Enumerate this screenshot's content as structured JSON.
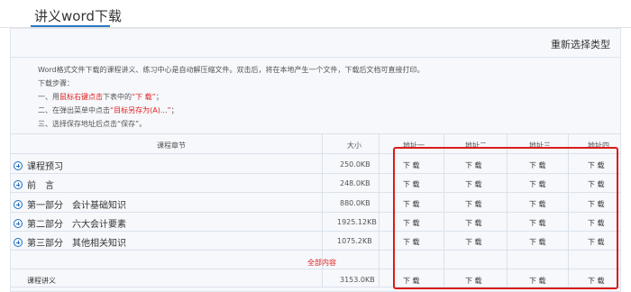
{
  "tab": {
    "title": "讲义word下载"
  },
  "toolbar": {
    "reselect_label": "重新选择类型"
  },
  "intro": {
    "line1": "Word格式文件下载的课程讲义、练习中心是自动解压缩文件。双击后，将在本地产生一个文件，下载后文档可直接打印。",
    "line2": "下载步骤：",
    "line3_a": "一、用",
    "line3_b": "鼠标右键点击",
    "line3_c": "下表中的",
    "line3_d": "“下 载”",
    "line3_e": "；",
    "line4_a": "二、在弹出菜单中点击",
    "line4_b": "“目标另存为(A)...”",
    "line4_c": "；",
    "line5": "三、选择保存地址后点击“保存”。"
  },
  "table": {
    "headers": {
      "chapter": "课程章节",
      "size": "大小",
      "addr1": "地址一",
      "addr2": "地址二",
      "addr3": "地址三",
      "addr4": "地址四"
    },
    "download_label": "下 载",
    "rows": [
      {
        "name": "课程预习",
        "size": "250.0KB"
      },
      {
        "name": "前　言",
        "size": "248.0KB"
      },
      {
        "name": "第一部分　会计基础知识",
        "size": "880.0KB"
      },
      {
        "name": "第二部分　六大会计要素",
        "size": "1925.12KB"
      },
      {
        "name": "第三部分　其他相关知识",
        "size": "1075.2KB"
      }
    ],
    "all_content_label": "全部内容",
    "summary_row": {
      "name": "课程讲义",
      "size": "3153.0KB"
    }
  },
  "colors": {
    "accent": "#2b78c5",
    "highlight": "#d91b1b",
    "link_red": "#e02020"
  }
}
